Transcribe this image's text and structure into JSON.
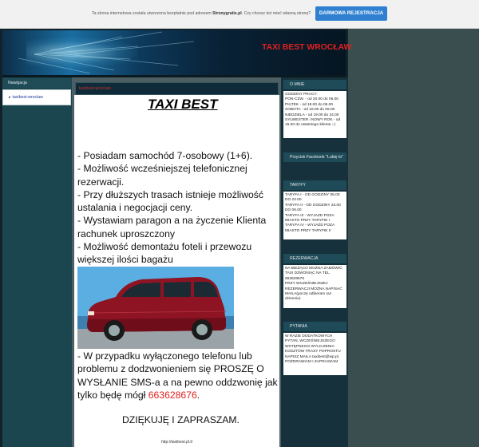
{
  "notice": {
    "text_before": "Ta strona internetowa została utworzona bezpłatnie pod adresem ",
    "site": "Stronygratis.pl",
    "text_after": ". Czy chcesz też mieć własną stronę?",
    "button": "DARMOWA REJESTRACJA"
  },
  "header": {
    "title": "TAXI BEST WROCŁAW"
  },
  "nav": {
    "title": "Nawigacja",
    "items": [
      "taxibest-wroclaw"
    ]
  },
  "main": {
    "title": "taxibest-wroclaw",
    "heading": "TAXI BEST",
    "lines": [
      "- Posiadam samochód  7-osobowy (1+6).",
      "- Możliwość wcześniejszej telefonicznej rezerwacji.",
      "- Przy dłuższych trasach istnieje możliwość ustalania i negocjacji ceny.",
      "- Wystawiam paragon a na życzenie Klienta rachunek uproszczony",
      "- Możliwość demontażu foteli i przewozu większej ilości bagażu"
    ],
    "closing_text": "- W przypadku wyłączonego telefonu lub problemu z dodzwonieniem się PROSZĘ O WYSŁANIE  SMS-a a na pewno oddzwonię jak tylko będę mógł ",
    "phone": "663628676",
    "closing_end": ".",
    "thanks": "DZIĘKUJĘ I ZAPRASZAM.",
    "footer_url": "http://taxibest.pl.tl"
  },
  "sidebar": {
    "o_mnie": {
      "title": "O MNIE",
      "lines": [
        "GODZINY PRACY:",
        "PON-CZW. - od 20.00 do 06.00",
        "PIĄTEK - od 18.00 do 06.00",
        "SOBOTA - od 18.00 do 06.00",
        "NIEDZIELA - od 19.00 do 24.00",
        "SYLWESTER i NOWY ROK - od 15.00 do ostatniego klienta ;-)"
      ]
    },
    "facebook": {
      "title": "Przycisk Facebook \"Lubię to\""
    },
    "taryfy": {
      "title": "TARYFY",
      "lines": [
        "TARYFA I - OD GODZINY 06.00 DO 23.00",
        "TARYFA II - OD GODZINY 23.00 DO 06.00",
        "TARYFA III - WYJAZD POZA MIASTO PRZY TARYFIE I",
        "TARYFA IV - WYJAZD POZA MIASTO PRZY TARYFIE II"
      ]
    },
    "rezerwacja": {
      "title": "REZERWACJA",
      "lines": [
        "NA BIEŻĄCO MOŻNA ZAMÓWIĆ TAXI DZWONIĄC NA TEL. 663628676",
        "PRZY WCZEŚNIEJSZEJ REZERWACJI MOŻNA NAPISAĆ MAILA(poczę odbieram raz dziennie)"
      ]
    },
    "pytania": {
      "title": "PYTANIA",
      "lines": [
        "W RAZIE DODATKOWYCH PYTAŃ, WCZEŚNIEJSZEGO WSTĘPNEGO WYLICZENIA KOSZTÓW TRASY POPROSTU NAPISZ MAILA taxibest@wp.pl.",
        "POZDRAWIAM I ZAPRASZAM"
      ]
    }
  }
}
